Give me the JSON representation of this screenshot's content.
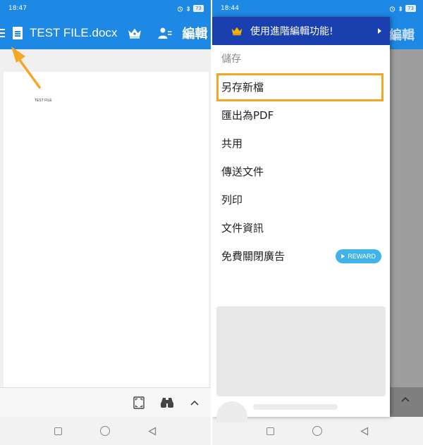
{
  "left": {
    "status": {
      "time": "18:47",
      "battery": "73"
    },
    "appbar": {
      "file_title": "TEST FILE.docx",
      "edit_label": "編輯"
    },
    "document": {
      "text": "TEST FILE"
    }
  },
  "right": {
    "status": {
      "time": "18:44",
      "battery": "73"
    },
    "appbar": {
      "edit_label": "編輯"
    },
    "drawer": {
      "promo_label": "使用進階編輯功能!",
      "section_header": "儲存",
      "items": [
        {
          "label": "另存新檔"
        },
        {
          "label": "匯出為PDF"
        },
        {
          "label": "共用"
        },
        {
          "label": "傳送文件"
        },
        {
          "label": "列印"
        },
        {
          "label": "文件資訊"
        },
        {
          "label": "免費關閉廣告"
        }
      ],
      "reward_label": "REWARD"
    }
  },
  "colors": {
    "appbar": "#1e88e5",
    "promo": "#1a3fae",
    "highlight": "#f5a623",
    "reward": "#40b4e8",
    "crown": "#f5b400"
  },
  "icons": [
    "menu-icon",
    "document-icon",
    "crown-icon",
    "person-edit-icon",
    "fullscreen-icon",
    "binoculars-icon",
    "chevron-up-icon",
    "arrow-annotation"
  ]
}
